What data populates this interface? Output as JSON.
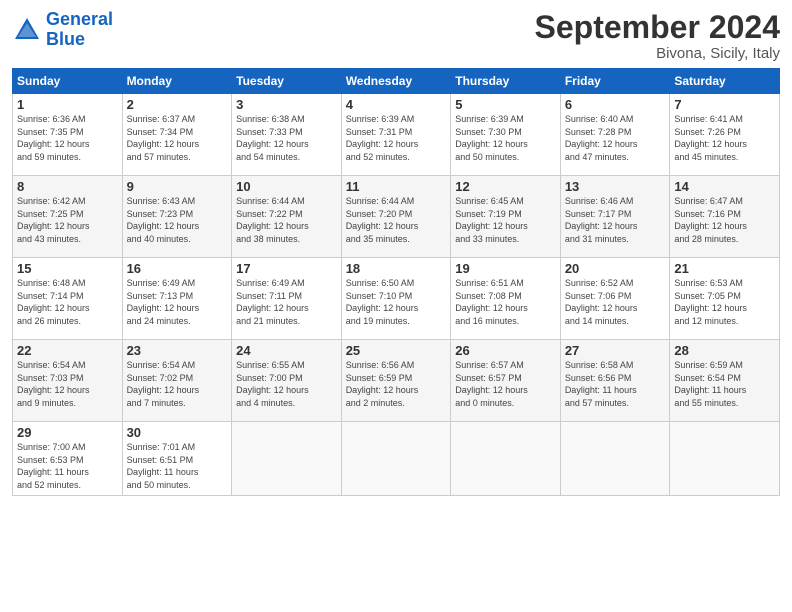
{
  "header": {
    "logo_general": "General",
    "logo_blue": "Blue",
    "month": "September 2024",
    "location": "Bivona, Sicily, Italy"
  },
  "weekdays": [
    "Sunday",
    "Monday",
    "Tuesday",
    "Wednesday",
    "Thursday",
    "Friday",
    "Saturday"
  ],
  "weeks": [
    [
      {
        "day": "1",
        "info": "Sunrise: 6:36 AM\nSunset: 7:35 PM\nDaylight: 12 hours\nand 59 minutes."
      },
      {
        "day": "2",
        "info": "Sunrise: 6:37 AM\nSunset: 7:34 PM\nDaylight: 12 hours\nand 57 minutes."
      },
      {
        "day": "3",
        "info": "Sunrise: 6:38 AM\nSunset: 7:33 PM\nDaylight: 12 hours\nand 54 minutes."
      },
      {
        "day": "4",
        "info": "Sunrise: 6:39 AM\nSunset: 7:31 PM\nDaylight: 12 hours\nand 52 minutes."
      },
      {
        "day": "5",
        "info": "Sunrise: 6:39 AM\nSunset: 7:30 PM\nDaylight: 12 hours\nand 50 minutes."
      },
      {
        "day": "6",
        "info": "Sunrise: 6:40 AM\nSunset: 7:28 PM\nDaylight: 12 hours\nand 47 minutes."
      },
      {
        "day": "7",
        "info": "Sunrise: 6:41 AM\nSunset: 7:26 PM\nDaylight: 12 hours\nand 45 minutes."
      }
    ],
    [
      {
        "day": "8",
        "info": "Sunrise: 6:42 AM\nSunset: 7:25 PM\nDaylight: 12 hours\nand 43 minutes."
      },
      {
        "day": "9",
        "info": "Sunrise: 6:43 AM\nSunset: 7:23 PM\nDaylight: 12 hours\nand 40 minutes."
      },
      {
        "day": "10",
        "info": "Sunrise: 6:44 AM\nSunset: 7:22 PM\nDaylight: 12 hours\nand 38 minutes."
      },
      {
        "day": "11",
        "info": "Sunrise: 6:44 AM\nSunset: 7:20 PM\nDaylight: 12 hours\nand 35 minutes."
      },
      {
        "day": "12",
        "info": "Sunrise: 6:45 AM\nSunset: 7:19 PM\nDaylight: 12 hours\nand 33 minutes."
      },
      {
        "day": "13",
        "info": "Sunrise: 6:46 AM\nSunset: 7:17 PM\nDaylight: 12 hours\nand 31 minutes."
      },
      {
        "day": "14",
        "info": "Sunrise: 6:47 AM\nSunset: 7:16 PM\nDaylight: 12 hours\nand 28 minutes."
      }
    ],
    [
      {
        "day": "15",
        "info": "Sunrise: 6:48 AM\nSunset: 7:14 PM\nDaylight: 12 hours\nand 26 minutes."
      },
      {
        "day": "16",
        "info": "Sunrise: 6:49 AM\nSunset: 7:13 PM\nDaylight: 12 hours\nand 24 minutes."
      },
      {
        "day": "17",
        "info": "Sunrise: 6:49 AM\nSunset: 7:11 PM\nDaylight: 12 hours\nand 21 minutes."
      },
      {
        "day": "18",
        "info": "Sunrise: 6:50 AM\nSunset: 7:10 PM\nDaylight: 12 hours\nand 19 minutes."
      },
      {
        "day": "19",
        "info": "Sunrise: 6:51 AM\nSunset: 7:08 PM\nDaylight: 12 hours\nand 16 minutes."
      },
      {
        "day": "20",
        "info": "Sunrise: 6:52 AM\nSunset: 7:06 PM\nDaylight: 12 hours\nand 14 minutes."
      },
      {
        "day": "21",
        "info": "Sunrise: 6:53 AM\nSunset: 7:05 PM\nDaylight: 12 hours\nand 12 minutes."
      }
    ],
    [
      {
        "day": "22",
        "info": "Sunrise: 6:54 AM\nSunset: 7:03 PM\nDaylight: 12 hours\nand 9 minutes."
      },
      {
        "day": "23",
        "info": "Sunrise: 6:54 AM\nSunset: 7:02 PM\nDaylight: 12 hours\nand 7 minutes."
      },
      {
        "day": "24",
        "info": "Sunrise: 6:55 AM\nSunset: 7:00 PM\nDaylight: 12 hours\nand 4 minutes."
      },
      {
        "day": "25",
        "info": "Sunrise: 6:56 AM\nSunset: 6:59 PM\nDaylight: 12 hours\nand 2 minutes."
      },
      {
        "day": "26",
        "info": "Sunrise: 6:57 AM\nSunset: 6:57 PM\nDaylight: 12 hours\nand 0 minutes."
      },
      {
        "day": "27",
        "info": "Sunrise: 6:58 AM\nSunset: 6:56 PM\nDaylight: 11 hours\nand 57 minutes."
      },
      {
        "day": "28",
        "info": "Sunrise: 6:59 AM\nSunset: 6:54 PM\nDaylight: 11 hours\nand 55 minutes."
      }
    ],
    [
      {
        "day": "29",
        "info": "Sunrise: 7:00 AM\nSunset: 6:53 PM\nDaylight: 11 hours\nand 52 minutes."
      },
      {
        "day": "30",
        "info": "Sunrise: 7:01 AM\nSunset: 6:51 PM\nDaylight: 11 hours\nand 50 minutes."
      },
      {
        "day": "",
        "info": ""
      },
      {
        "day": "",
        "info": ""
      },
      {
        "day": "",
        "info": ""
      },
      {
        "day": "",
        "info": ""
      },
      {
        "day": "",
        "info": ""
      }
    ]
  ]
}
